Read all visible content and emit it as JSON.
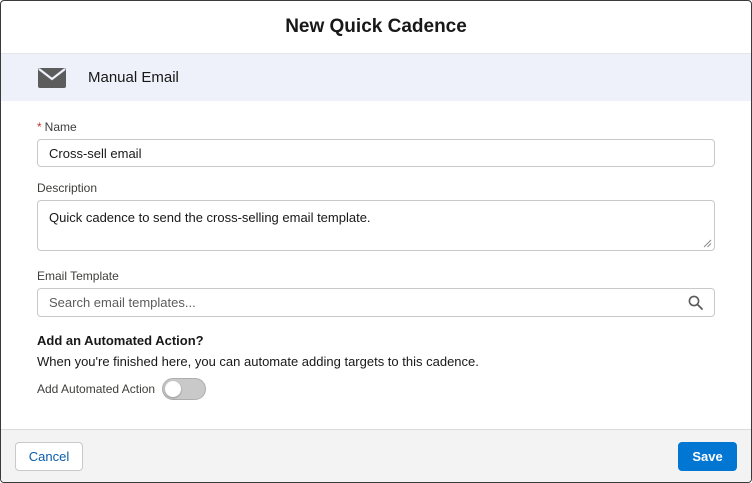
{
  "dialog": {
    "title": "New Quick Cadence"
  },
  "banner": {
    "icon": "email-icon",
    "label": "Manual Email"
  },
  "form": {
    "name": {
      "required_marker": "*",
      "label": "Name",
      "value": "Cross-sell email"
    },
    "description": {
      "label": "Description",
      "value": "Quick cadence to send the cross-selling email template."
    },
    "email_template": {
      "label": "Email Template",
      "placeholder": "Search email templates...",
      "icon": "search-icon"
    },
    "automated_action": {
      "title": "Add an Automated Action?",
      "description": "When you're finished here, you can automate adding targets to this cadence.",
      "toggle_label": "Add Automated Action",
      "toggle_on": false
    }
  },
  "footer": {
    "cancel_label": "Cancel",
    "save_label": "Save"
  },
  "colors": {
    "brand": "#0176d3",
    "banner_bg": "#eef1f9",
    "required": "#c23934"
  }
}
